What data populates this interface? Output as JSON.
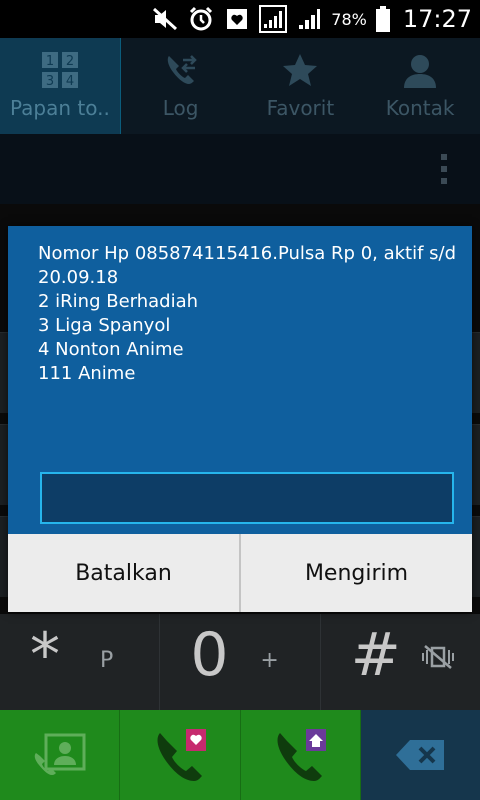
{
  "status_bar": {
    "icons": [
      "mute-icon",
      "alarm-icon",
      "notification-icon",
      "signal-sim1-icon",
      "signal-sim2-icon",
      "battery-icon"
    ],
    "battery": "78%",
    "time": "17:27"
  },
  "tabs": [
    {
      "label": "Papan to..",
      "icon": "keypad-icon",
      "active": true
    },
    {
      "label": "Log",
      "icon": "call-log-icon",
      "active": false
    },
    {
      "label": "Favorit",
      "icon": "star-icon",
      "active": false
    },
    {
      "label": "Kontak",
      "icon": "contact-icon",
      "active": false
    }
  ],
  "dialog": {
    "message": "Nomor Hp 085874115416.Pulsa Rp 0, aktif s/d 20.09.18\n2 iRing Berhadiah\n3 Liga Spanyol\n4 Nonton Anime\n111 Anime",
    "input_value": "",
    "cancel_label": "Batalkan",
    "send_label": "Mengirim"
  },
  "keypad": {
    "star": {
      "main": "*",
      "sub": "P"
    },
    "zero": {
      "main": "0",
      "sub": "+"
    },
    "hash": {
      "main": "#",
      "sub": ""
    }
  },
  "colors": {
    "dialog_bg": "#0f5f9e",
    "input_border": "#26b5ec",
    "call_green": "#1f8a1c",
    "tab_active": "#0e3a52"
  }
}
